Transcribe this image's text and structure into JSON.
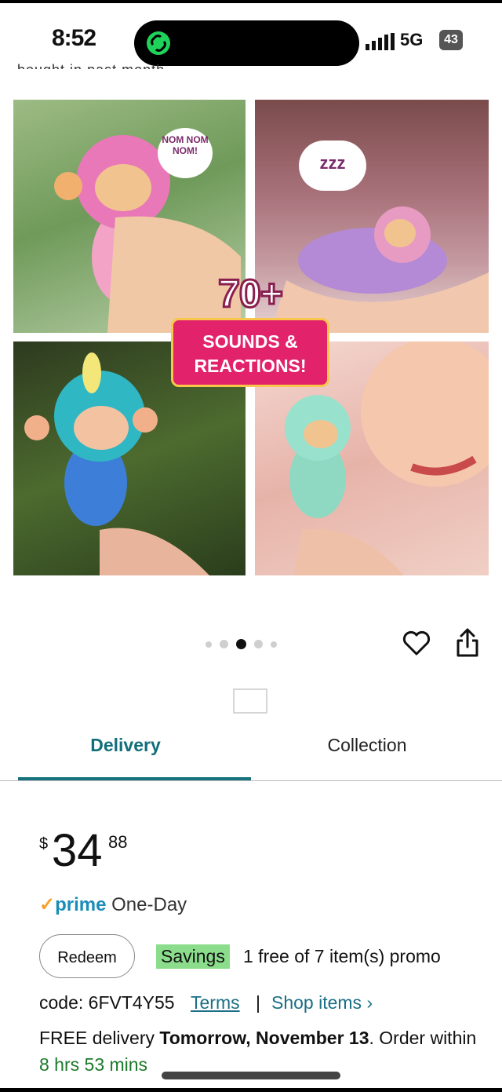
{
  "status_bar": {
    "time": "8:52",
    "network": "5G",
    "battery": "43"
  },
  "top_cut_text": "bought in past month",
  "hero": {
    "bubble_text": "NOM NOM NOM!",
    "zzz_text": "zzz",
    "badge_number": "70+",
    "badge_line1": "SOUNDS &",
    "badge_line2": "REACTIONS!"
  },
  "carousel": {
    "dot_count": 5,
    "active_index": 2
  },
  "tabs": {
    "delivery": "Delivery",
    "collection": "Collection"
  },
  "price": {
    "currency": "$",
    "whole": "34",
    "fraction": "88"
  },
  "prime": {
    "check": "✓",
    "word": "prime",
    "label": "One-Day"
  },
  "promo": {
    "redeem_label": "Redeem",
    "savings_label": "Savings",
    "text": "1 free of 7 item(s) promo",
    "code_text": "code: 6FVT4Y55",
    "terms_label": "Terms",
    "separator": "|",
    "shop_items_label": "Shop items ›"
  },
  "delivery": {
    "prefix": "FREE delivery ",
    "date": "Tomorrow, November 13",
    "middle": ". Order within ",
    "countdown": "8 hrs 53 mins"
  },
  "colors": {
    "accent_teal": "#106f7a",
    "savings_green": "#8bdd8c",
    "prime_blue": "#1a8db8",
    "badge_pink": "#e3226c"
  }
}
